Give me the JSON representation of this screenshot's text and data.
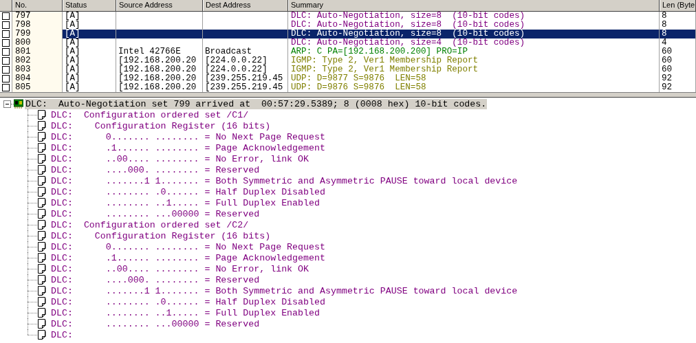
{
  "table": {
    "columns": [
      "No.",
      "Status",
      "Source Address",
      "Dest Address",
      "Summary",
      "Len (Byte"
    ],
    "rows": [
      {
        "checked": false,
        "selected": false,
        "no": "797",
        "status": "[A]",
        "source": "",
        "dest": "",
        "summary": "DLC: Auto-Negotiation, size=8  (10-bit codes)",
        "color": "#800080",
        "len": "8"
      },
      {
        "checked": false,
        "selected": false,
        "no": "798",
        "status": "[A]",
        "source": "",
        "dest": "",
        "summary": "DLC: Auto-Negotiation, size=8  (10-bit codes)",
        "color": "#800080",
        "len": "8"
      },
      {
        "checked": false,
        "selected": true,
        "no": "799",
        "status": "[A]",
        "source": "",
        "dest": "",
        "summary": "DLC: Auto-Negotiation, size=8  (10-bit codes)",
        "len": "8"
      },
      {
        "checked": false,
        "selected": false,
        "no": "800",
        "status": "[A]",
        "source": "",
        "dest": "",
        "summary": "DLC: Auto-Negotiation, size=4  (10-bit codes)",
        "color": "#800080",
        "len": "4"
      },
      {
        "checked": false,
        "selected": false,
        "no": "801",
        "status": "[A]",
        "source": "Intel 42766E",
        "dest": "Broadcast",
        "summary": "ARP: C PA=[192.168.200.200] PRO=IP",
        "color": "#008000",
        "len": "60"
      },
      {
        "checked": false,
        "selected": false,
        "no": "802",
        "status": "[A]",
        "source": "[192.168.200.20",
        "dest": "[224.0.0.22]",
        "summary": "IGMP: Type 2, Ver1 Membership Report",
        "color": "#808000",
        "len": "60"
      },
      {
        "checked": false,
        "selected": false,
        "no": "803",
        "status": "[A]",
        "source": "[192.168.200.20",
        "dest": "[224.0.0.22]",
        "summary": "IGMP: Type 2, Ver1 Membership Report",
        "color": "#808000",
        "len": "60"
      },
      {
        "checked": false,
        "selected": false,
        "no": "804",
        "status": "[A]",
        "source": "[192.168.200.20",
        "dest": "[239.255.219.45",
        "summary": "UDP: D=9877 S=9876  LEN=58",
        "color": "#808000",
        "len": "92"
      },
      {
        "checked": false,
        "selected": false,
        "no": "805",
        "status": "[A]",
        "source": "[192.168.200.20",
        "dest": "[239.255.219.45",
        "summary": "UDP: D=9876 S=9876  LEN=58",
        "color": "#808000",
        "len": "92"
      }
    ]
  },
  "detail": {
    "expanded": true,
    "text": "DLC:  Auto-Negotiation set 799 arrived at  00:57:29.5389; 8 (0008 hex) 10-bit codes.",
    "children": [
      {
        "text": "DLC:  Configuration ordered set /C1/"
      },
      {
        "text": "DLC:    Configuration Register (16 bits)"
      },
      {
        "text": "DLC:      0....... ........ = No Next Page Request"
      },
      {
        "text": "DLC:      .1...... ........ = Page Acknowledgement"
      },
      {
        "text": "DLC:      ..00.... ........ = No Error, link OK"
      },
      {
        "text": "DLC:      ....000. ........ = Reserved"
      },
      {
        "text": "DLC:      .......1 1....... = Both Symmetric and Asymmetric PAUSE toward local device"
      },
      {
        "text": "DLC:      ........ .0...... = Half Duplex Disabled"
      },
      {
        "text": "DLC:      ........ ..1..... = Full Duplex Enabled"
      },
      {
        "text": "DLC:      ........ ...00000 = Reserved"
      },
      {
        "text": "DLC:  Configuration ordered set /C2/"
      },
      {
        "text": "DLC:    Configuration Register (16 bits)"
      },
      {
        "text": "DLC:      0....... ........ = No Next Page Request"
      },
      {
        "text": "DLC:      .1...... ........ = Page Acknowledgement"
      },
      {
        "text": "DLC:      ..00.... ........ = No Error, link OK"
      },
      {
        "text": "DLC:      ....000. ........ = Reserved"
      },
      {
        "text": "DLC:      .......1 1....... = Both Symmetric and Asymmetric PAUSE toward local device"
      },
      {
        "text": "DLC:      ........ .0...... = Half Duplex Disabled"
      },
      {
        "text": "DLC:      ........ ..1..... = Full Duplex Enabled"
      },
      {
        "text": "DLC:      ........ ...00000 = Reserved"
      },
      {
        "text": "DLC:"
      }
    ]
  }
}
